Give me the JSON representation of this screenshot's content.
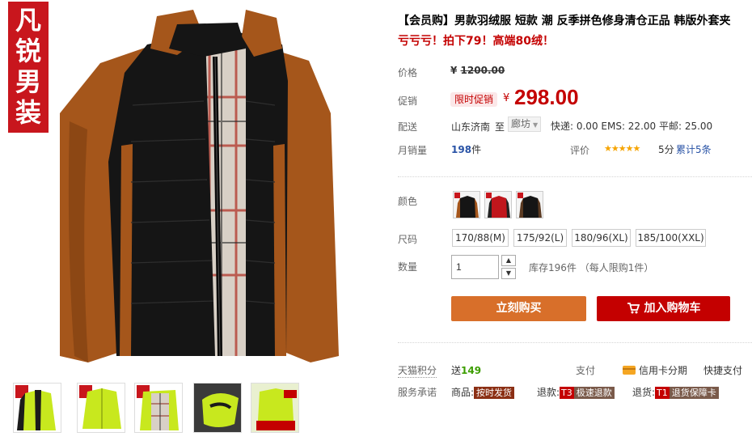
{
  "brand_badge": [
    "凡",
    "锐",
    "男",
    "装"
  ],
  "product": {
    "title": "【会员购】男款羽绒服 短款 潮 反季拼色修身清仓正品 韩版外套夹",
    "subtitle": "亏亏亏！拍下79！高端80绒！"
  },
  "price": {
    "label": "价格",
    "currency": "¥",
    "original": "1200.00",
    "promo_label": "促销",
    "promo_tag": "限时促销",
    "current": "298.00"
  },
  "shipping": {
    "label": "配送",
    "from": "山东济南",
    "to_word": "至",
    "district": "廊坊",
    "rates": "快递: 0.00 EMS: 22.00 平邮: 25.00"
  },
  "sales": {
    "label": "月销量",
    "count": "198",
    "unit": "件",
    "rating_label": "评价",
    "stars": "★★★★★",
    "score": "5分",
    "reviews": "累计5条"
  },
  "color": {
    "label": "颜色",
    "options": [
      "black-jacket",
      "red-jacket",
      "brown-jacket"
    ]
  },
  "size": {
    "label": "尺码",
    "options": [
      "170/88(M)",
      "175/92(L)",
      "180/96(XL)",
      "185/100(XXL)"
    ]
  },
  "quantity": {
    "label": "数量",
    "value": "1",
    "stock": "库存196件 （每人限购1件）"
  },
  "actions": {
    "buy_now": "立刻购买",
    "add_to_cart": "加入购物车"
  },
  "points": {
    "label": "天猫积分",
    "prefix": "送",
    "value": "149",
    "pay_label": "支付",
    "credit": "信用卡分期",
    "quick_pay": "快捷支付"
  },
  "service": {
    "label": "服务承诺",
    "goods": "商品:",
    "goods_tag": "按时发货",
    "refund": "退款:",
    "refund_code": "T3",
    "refund_tag": "极速退款",
    "return": "退货:",
    "return_code": "T1",
    "return_tag": "退货保障卡"
  },
  "colors": {
    "accent_red": "#c40000",
    "buy_orange": "#d86f2a",
    "badge_red": "#c8161d",
    "jacket_black": "#111111",
    "jacket_orange": "#a5561b",
    "thumb_lime": "#c8e81e"
  },
  "thumbnails": [
    "lime-jacket-front",
    "lime-jacket-flat",
    "plaid-lining",
    "lime-jacket-detail",
    "lime-jacket-promo"
  ]
}
